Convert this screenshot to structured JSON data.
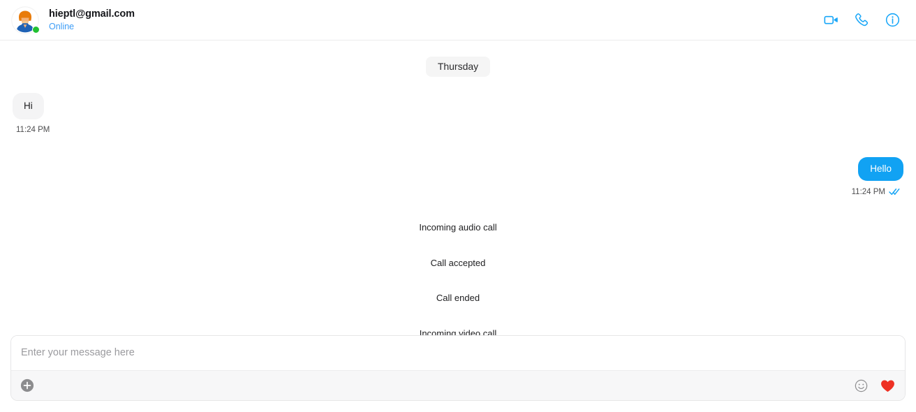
{
  "header": {
    "peer_name": "hieptl@gmail.com",
    "status": "Online",
    "avatar_name": "user-avatar",
    "actions": [
      {
        "name": "video-call-icon",
        "label": "Video call"
      },
      {
        "name": "audio-call-icon",
        "label": "Audio call"
      },
      {
        "name": "info-icon",
        "label": "Conversation info"
      }
    ]
  },
  "conversation": {
    "day_divider": "Thursday",
    "messages": [
      {
        "kind": "incoming",
        "text": "Hi",
        "time": "11:24 PM"
      },
      {
        "kind": "outgoing",
        "text": "Hello",
        "time": "11:24 PM",
        "receipt": "read"
      },
      {
        "kind": "system",
        "text": "Incoming audio call"
      },
      {
        "kind": "system",
        "text": "Call accepted"
      },
      {
        "kind": "system",
        "text": "Call ended"
      },
      {
        "kind": "system",
        "text": "Incoming video call"
      }
    ]
  },
  "composer": {
    "placeholder": "Enter your message here",
    "value": "",
    "attach_label": "Add attachment",
    "emoji_label": "Emoji picker",
    "like_label": "Send heart"
  },
  "colors": {
    "accent_blue": "#11a2f3",
    "status_blue": "#3e9df6",
    "online_green": "#21c032",
    "incoming_bubble": "#f4f4f5",
    "day_pill": "#f5f5f5",
    "heart_red": "#ee3124",
    "toolbar_gray": "#f7f7f8"
  }
}
